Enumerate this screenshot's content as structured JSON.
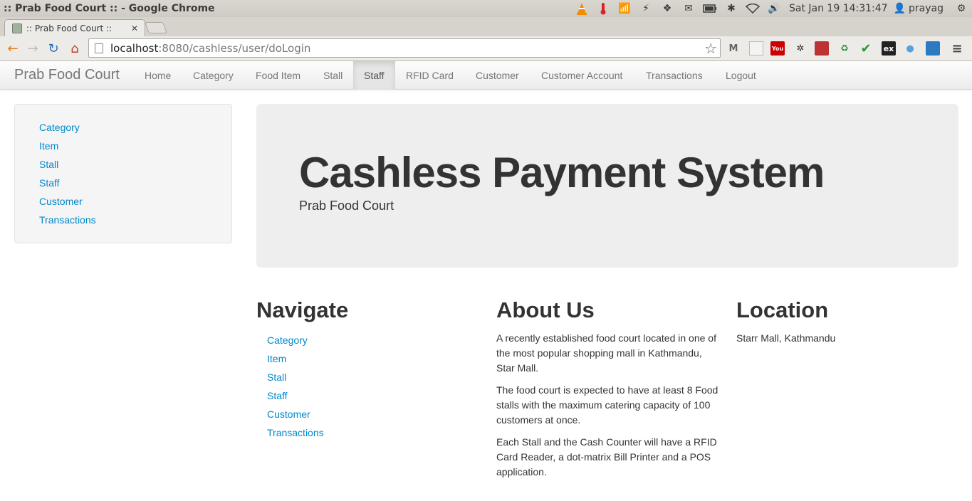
{
  "os": {
    "window_title": ":: Prab Food Court :: - Google Chrome",
    "clock": "Sat Jan 19 14:31:47",
    "user": "prayag"
  },
  "browser": {
    "tab_title": ":: Prab Food Court ::",
    "url_host": "localhost",
    "url_rest": ":8080/cashless/user/doLogin"
  },
  "navbar": {
    "brand": "Prab Food Court",
    "items": [
      {
        "label": "Home"
      },
      {
        "label": "Category"
      },
      {
        "label": "Food Item"
      },
      {
        "label": "Stall"
      },
      {
        "label": "Staff",
        "active": true
      },
      {
        "label": "RFID Card"
      },
      {
        "label": "Customer"
      },
      {
        "label": "Customer Account"
      },
      {
        "label": "Transactions"
      },
      {
        "label": "Logout"
      }
    ]
  },
  "sidebar": {
    "links": [
      "Category",
      "Item",
      "Stall",
      "Staff",
      "Customer",
      "Transactions"
    ]
  },
  "hero": {
    "title": "Cashless Payment System",
    "subtitle": "Prab Food Court"
  },
  "navigate": {
    "heading": "Navigate",
    "links": [
      "Category",
      "Item",
      "Stall",
      "Staff",
      "Customer",
      "Transactions"
    ]
  },
  "about": {
    "heading": "About Us",
    "paragraphs": [
      "A recently established food court located in one of the most popular shopping mall in Kathmandu, Star Mall.",
      "The food court is expected to have at least 8 Food stalls with the maximum catering capacity of 100 customers at once.",
      "Each Stall and the Cash Counter will have a RFID Card Reader, a dot-matrix Bill Printer and a POS application."
    ]
  },
  "location": {
    "heading": "Location",
    "text": "Starr Mall, Kathmandu"
  },
  "colors": {
    "link": "#0088cc",
    "hero_bg": "#eeeeee",
    "sidebar_bg": "#f5f5f5"
  }
}
